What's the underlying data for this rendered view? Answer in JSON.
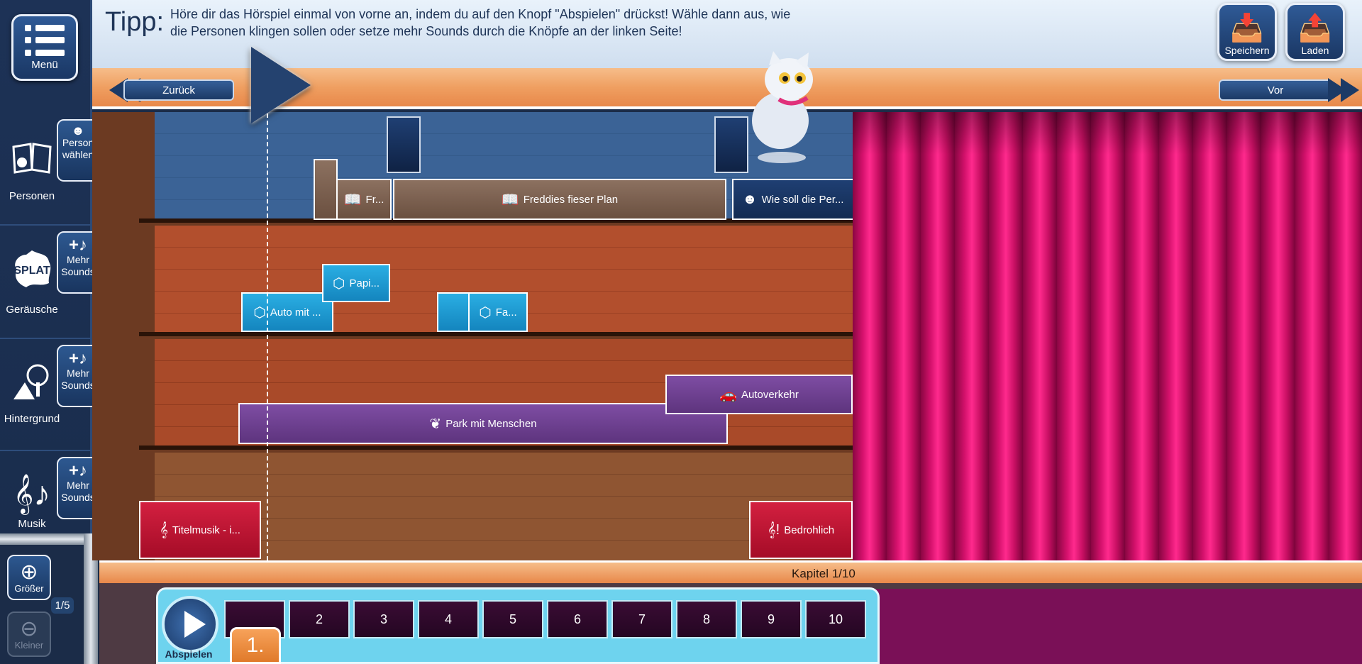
{
  "sidebar": {
    "menu_label": "Menü",
    "categories": [
      {
        "label": "Personen",
        "button": "Person wählen",
        "icon": "book-reader-icon"
      },
      {
        "label": "Geräusche",
        "button": "Mehr Sounds",
        "icon": "splat-icon"
      },
      {
        "label": "Hintergrund",
        "button": "Mehr Sounds",
        "icon": "tree-icon"
      },
      {
        "label": "Musik",
        "button": "Mehr Sounds",
        "icon": "music-notes-icon"
      }
    ],
    "zoom_in_label": "Größer",
    "zoom_out_label": "Kleiner",
    "zoom_level": "1/5"
  },
  "tip": {
    "title": "Tipp:",
    "text": "Höre dir das Hörspiel einmal von vorne an, indem du auf den Knopf \"Abspielen\" drückst! Wähle dann aus, wie die Personen klingen sollen oder setze mehr Sounds durch die Knöpfe an der linken Seite!"
  },
  "top_buttons": {
    "save": "Speichern",
    "load": "Laden"
  },
  "nav": {
    "back": "Zurück",
    "forward": "Vor"
  },
  "clips": {
    "persons": [
      "Fr...",
      "Freddies fieser Plan",
      "Wie soll die Per..."
    ],
    "noises": [
      "Auto mit ...",
      "Papi...",
      "Fa..."
    ],
    "background": [
      "Park mit Menschen",
      "Autoverkehr"
    ],
    "music": [
      "Titelmusik - i...",
      "Bedrohlich"
    ]
  },
  "chapter": {
    "label": "Kapitel 1/10",
    "play_label": "Abspielen",
    "current": "1.",
    "cells": [
      "",
      "2",
      "3",
      "4",
      "5",
      "6",
      "7",
      "8",
      "9",
      "10"
    ]
  },
  "colors": {
    "accent": "#1c3a66",
    "curtain": "#d4116c",
    "nav_bar": "#ef9f61"
  }
}
